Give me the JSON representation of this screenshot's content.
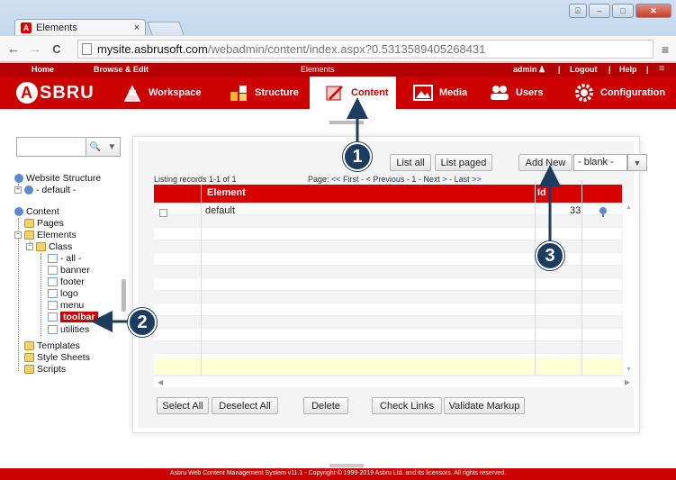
{
  "browser": {
    "tab_title": "Elements",
    "tab_close": "×",
    "url_host": "mysite.asbrusoft.com",
    "url_path": "/webadmin/content/index.aspx?0.5313589405268431",
    "back": "←",
    "forward": "→",
    "reload": "C",
    "menu": "≡",
    "minimize": "–",
    "maximize": "□",
    "close": "✕",
    "user": "⍓"
  },
  "topbar": {
    "home": "Home",
    "browse_edit": "Browse & Edit",
    "section": "Elements",
    "admin": "admin",
    "sep1": "|",
    "logout": "Logout",
    "sep2": "|",
    "help": "Help",
    "sep3": "|",
    "menu": "≡"
  },
  "navbar": {
    "logo_letter": "A",
    "logo_text": "SBRU",
    "items": [
      {
        "label": "Workspace",
        "icon": "workspace-icon"
      },
      {
        "label": "Structure",
        "icon": "structure-icon"
      },
      {
        "label": "Content",
        "icon": "content-icon",
        "active": true
      },
      {
        "label": "Media",
        "icon": "media-icon"
      },
      {
        "label": "Users",
        "icon": "users-icon"
      },
      {
        "label": "Configuration",
        "icon": "configuration-icon"
      }
    ]
  },
  "sidebar": {
    "search_placeholder": "",
    "tree": {
      "website_structure": "Website Structure",
      "default": "- default -",
      "content": "Content",
      "pages": "Pages",
      "elements": "Elements",
      "class": "Class",
      "all": "- all -",
      "banner": "banner",
      "footer": "footer",
      "logo": "logo",
      "menu": "menu",
      "toolbar": "toolbar",
      "utilities": "utilities",
      "templates": "Templates",
      "style_sheets": "Style Sheets",
      "scripts": "Scripts"
    }
  },
  "panel": {
    "list_all": "List all",
    "list_paged": "List paged",
    "add_new": "Add New",
    "select_value": "- blank -",
    "select_arrow": "▼",
    "listing": "Listing records 1-1 of 1",
    "pager_label": "Page:",
    "pager_first": "<< First",
    "pager_dash1": " - ",
    "pager_prev": "< Previous",
    "pager_dash2": " - ",
    "pager_num": "1",
    "pager_dash3": " - ",
    "pager_next": "Next >",
    "pager_dash4": " - ",
    "pager_last": "Last >>",
    "columns": {
      "element": "Element",
      "id": "Id"
    },
    "rows": [
      {
        "element": "default",
        "id": "33"
      }
    ],
    "buttons": {
      "select_all": "Select All",
      "deselect_all": "Deselect All",
      "delete": "Delete",
      "check_links": "Check Links",
      "validate_markup": "Validate Markup"
    }
  },
  "footer": {
    "text": "Asbru Web Content Management System v11.1 - Copyright © 1999-2019 Asbru Ltd. and its licensors. All rights reserved."
  },
  "annotations": {
    "one": "1",
    "two": "2",
    "three": "3"
  },
  "colors": {
    "brand_red": "#cc0000",
    "dark_red": "#b30000",
    "callout": "#1c3d5f"
  }
}
